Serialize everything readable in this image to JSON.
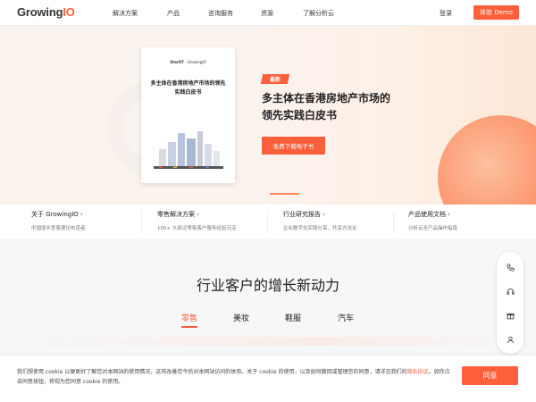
{
  "header": {
    "logo_text_a": "Growing",
    "logo_text_b": "IO",
    "nav": [
      "解决方案",
      "产品",
      "咨询服务",
      "资源",
      "了解分析云"
    ],
    "login": "登录",
    "demo": "体验 Demo"
  },
  "hero": {
    "book_logo_left": "StarOT",
    "book_logo_right": "GrowingIO",
    "book_title": "多主体在香港房地产市场的领先实践白皮书",
    "badge": "最新",
    "title_line1": "多主体在香港房地产市场的",
    "title_line2": "领先实践白皮书",
    "cta": "免费下载电子书"
  },
  "features": [
    {
      "title": "关于 GrowingIO",
      "desc": "中国增长型客理论布道者"
    },
    {
      "title": "零售解决方案",
      "desc": "100+ 头部泛零售客户服务经验沉淀"
    },
    {
      "title": "行业研究报告",
      "desc": "企业数字化实践分享，共享方法论"
    },
    {
      "title": "产品使用文档",
      "desc": "分析云全产品操作指南"
    }
  ],
  "section2": {
    "title": "行业客户的增长新动力",
    "tabs": [
      "零售",
      "美妆",
      "鞋服",
      "汽车"
    ],
    "active_tab": 0
  },
  "sidebar": {
    "icons": [
      "phone-icon",
      "headset-icon",
      "gift-icon",
      "user-icon"
    ]
  },
  "cookie": {
    "text_before": "我们想使用 cookie 以便更好了解您对本网站的使用情况，这将改善您今后对本网站访问的体验。关于 cookie 的使用，以及如何撤回或管理您的同意，请详见我们的",
    "link": "隐私协议",
    "text_after": "。如你点击同意按钮，将视为您同意 cookie 的使用。",
    "agree": "同意"
  },
  "colors": {
    "accent": "#fc5f3a"
  }
}
